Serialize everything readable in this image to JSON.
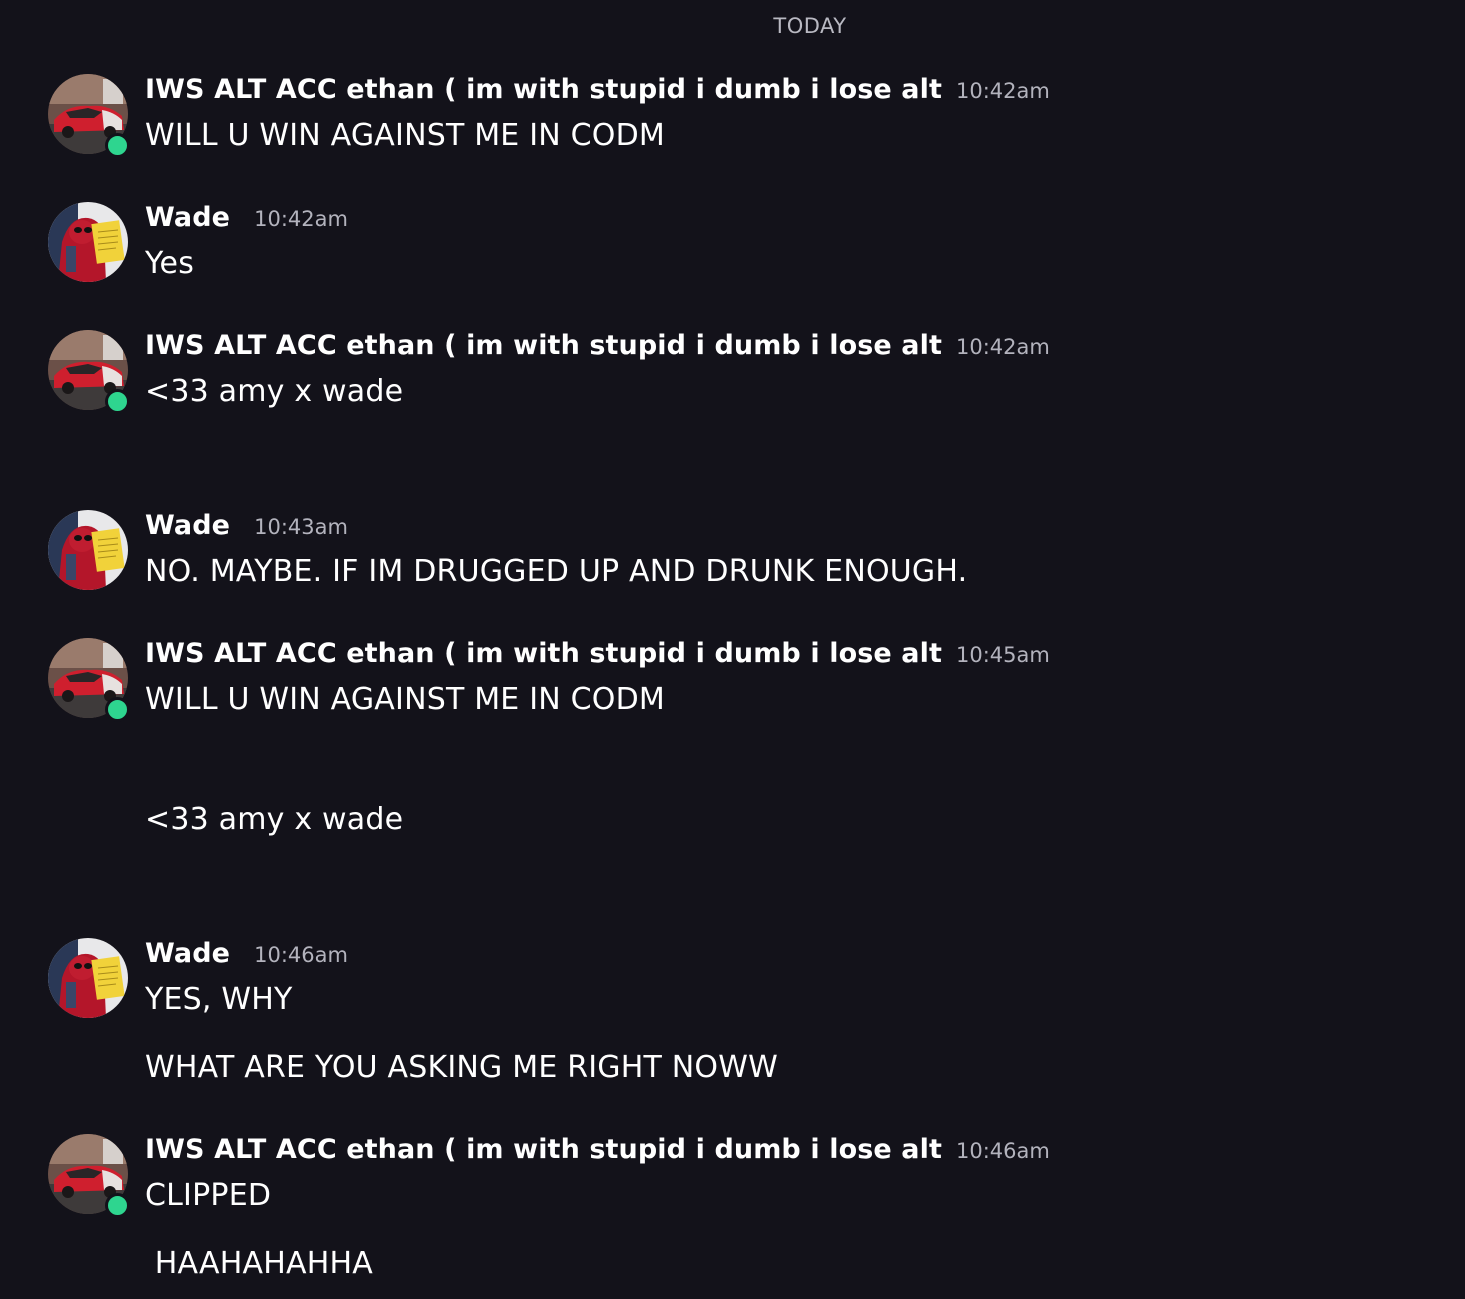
{
  "divider": "TODAY",
  "users": {
    "ethan": {
      "name": "IWS ALT ACC ethan ( im with stupid i dumb i lose alt",
      "avatar_icon": "car-avatar-icon",
      "status": "online",
      "status_color": "#2ed58f"
    },
    "wade": {
      "name": "Wade",
      "avatar_icon": "deadpool-avatar-icon"
    }
  },
  "messages": [
    {
      "author": "IWS ALT ACC ethan ( im with stupid i dumb i lose alt",
      "time": "10:42am",
      "lines": [
        "WILL U WIN AGAINST ME IN CODM"
      ]
    },
    {
      "author": "Wade",
      "time": "10:42am",
      "lines": [
        "Yes"
      ]
    },
    {
      "author": "IWS ALT ACC ethan ( im with stupid i dumb i lose alt",
      "time": "10:42am",
      "lines": [
        "<33 amy x wade"
      ]
    },
    {
      "author": "Wade",
      "time": "10:43am",
      "lines": [
        "NO. MAYBE. IF IM DRUGGED UP AND DRUNK ENOUGH."
      ]
    },
    {
      "author": "IWS ALT ACC ethan ( im with stupid i dumb i lose alt",
      "time": "10:45am",
      "lines": [
        "WILL U WIN AGAINST ME IN CODM",
        "<33 amy x wade"
      ]
    },
    {
      "author": "Wade",
      "time": "10:46am",
      "lines": [
        "YES, WHY",
        "WHAT ARE YOU ASKING ME RIGHT NOWW"
      ]
    },
    {
      "author": "IWS ALT ACC ethan ( im with stupid i dumb i lose alt",
      "time": "10:46am",
      "lines": [
        "CLIPPED",
        " HAAHAHAHHA"
      ]
    }
  ],
  "colors": {
    "background": "#13121a",
    "text": "#ffffff",
    "timestamp": "#b3b3bd",
    "online": "#2ed58f"
  }
}
